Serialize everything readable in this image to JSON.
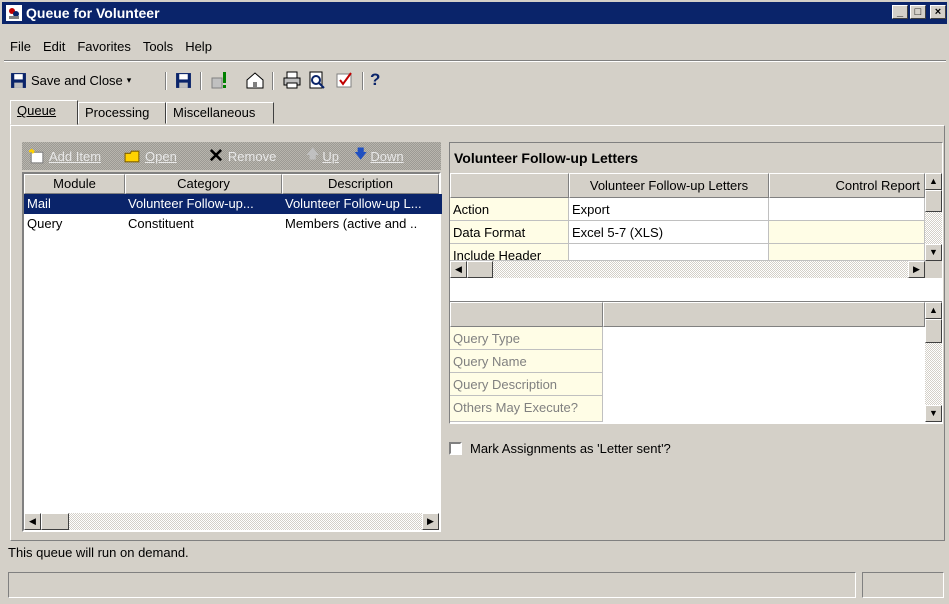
{
  "window": {
    "title": "Queue for Volunteer",
    "controls": [
      "_",
      "□",
      "×"
    ]
  },
  "menu": [
    "File",
    "Edit",
    "Favorites",
    "Tools",
    "Help"
  ],
  "toolbar": {
    "save_close": "Save and Close",
    "help": "?"
  },
  "tabs": [
    "Queue",
    "Processing",
    "Miscellaneous"
  ],
  "item_toolbar": {
    "add": "Add Item",
    "open": "Open",
    "remove": "Remove",
    "up": "Up",
    "down": "Down"
  },
  "list": {
    "columns": [
      "Module",
      "Category",
      "Description"
    ],
    "rows": [
      {
        "module": "Mail",
        "category": "Volunteer Follow-up...",
        "description": "Volunteer Follow-up L..."
      },
      {
        "module": "Query",
        "category": "Constituent",
        "description": "Members (active and .."
      }
    ]
  },
  "detail": {
    "title": "Volunteer Follow-up Letters",
    "grid_cols": [
      "Volunteer Follow-up Letters",
      "Control Report"
    ],
    "grid_rows": [
      {
        "label": "Action",
        "value": "Export"
      },
      {
        "label": "Data Format",
        "value": "Excel 5-7 (XLS)"
      },
      {
        "label": "Include Header",
        "value": ""
      }
    ],
    "query_rows": [
      "Query Type",
      "Query Name",
      "Query Description",
      "Others May Execute?"
    ],
    "checkbox_label": "Mark Assignments as 'Letter sent'?"
  },
  "status": {
    "message": "This queue will run on demand."
  }
}
